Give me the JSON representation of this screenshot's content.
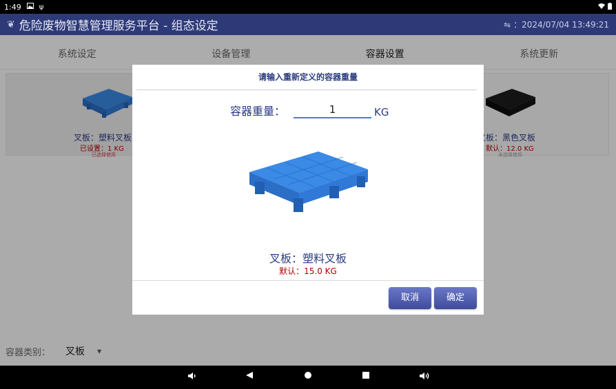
{
  "status_bar": {
    "time": "1:49",
    "left_icons": [
      "image-icon",
      "usb-icon"
    ],
    "right_icons": [
      "wifi-icon",
      "battery-icon"
    ]
  },
  "header": {
    "title": "危险废物智慧管理服务平台 - 组态设定",
    "datetime": "：2024/07/04 13:49:21",
    "brand_color": "#2e3a78"
  },
  "tabs": [
    {
      "label": "系统设定",
      "active": false
    },
    {
      "label": "设备管理",
      "active": false
    },
    {
      "label": "容器设置",
      "active": true
    },
    {
      "label": "系统更新",
      "active": false
    }
  ],
  "cards": {
    "left": {
      "name": "叉板：塑料叉板",
      "status": "已设置：1 KG",
      "note": "已选择使用",
      "color": "#3a86e0"
    },
    "right": {
      "name": "叉板：黑色叉板",
      "status": "默认：12.0 KG",
      "note": "未选择使用",
      "color": "#1a1a1a"
    }
  },
  "container_category": {
    "label": "容器类别：",
    "value": "叉板"
  },
  "dialog": {
    "title": "请输入重新定义的容器重量",
    "weight_label": "容器重量：",
    "weight_value": "1",
    "unit": "KG",
    "item_name": "叉板：塑料叉板",
    "item_default": "默认：15.0 KG",
    "cancel_label": "取消",
    "ok_label": "确定"
  },
  "android_nav": [
    "volume-down-icon",
    "back-icon",
    "home-icon",
    "recents-icon",
    "volume-up-icon"
  ]
}
